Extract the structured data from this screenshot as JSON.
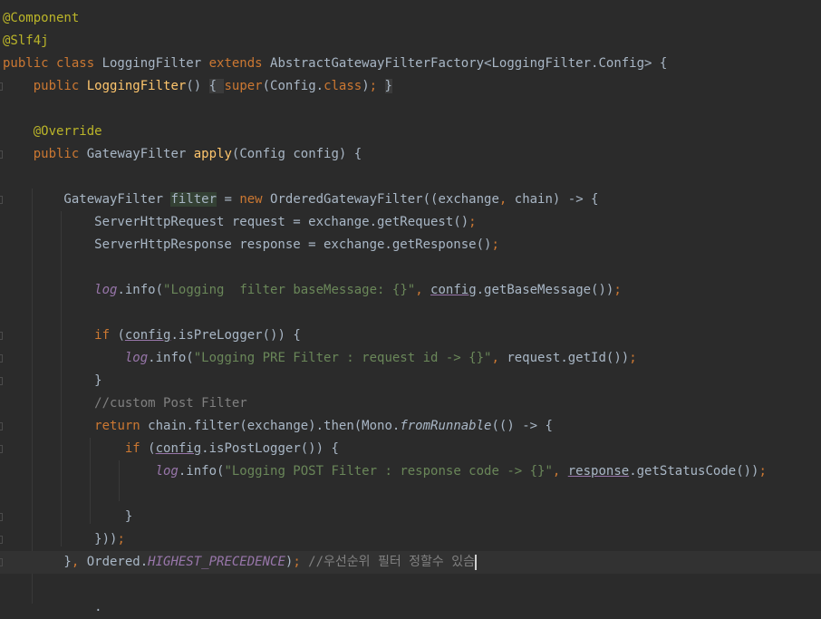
{
  "editor": {
    "lines": [
      {
        "tokens": [
          {
            "t": "@Component",
            "c": "ann"
          }
        ]
      },
      {
        "tokens": [
          {
            "t": "@Slf4j",
            "c": "ann"
          }
        ]
      },
      {
        "tokens": [
          {
            "t": "public class ",
            "c": "kw"
          },
          {
            "t": "LoggingFilter "
          },
          {
            "t": "extends ",
            "c": "kw"
          },
          {
            "t": "AbstractGatewayFilterFactory<LoggingFilter.Config> {"
          }
        ]
      },
      {
        "tokens": [
          {
            "t": "    "
          },
          {
            "t": "public ",
            "c": "kw"
          },
          {
            "t": "LoggingFilter",
            "c": "fn"
          },
          {
            "t": "() "
          },
          {
            "t": "{ ",
            "c": "fb"
          },
          {
            "t": "super",
            "c": "kw"
          },
          {
            "t": "(Config."
          },
          {
            "t": "class",
            "c": "kw"
          },
          {
            "t": ")"
          },
          {
            "t": "; ",
            "c": "kw"
          },
          {
            "t": "}",
            "c": "fb"
          }
        ]
      },
      {
        "tokens": []
      },
      {
        "tokens": [
          {
            "t": "    "
          },
          {
            "t": "@Override",
            "c": "ann"
          }
        ]
      },
      {
        "tokens": [
          {
            "t": "    "
          },
          {
            "t": "public ",
            "c": "kw"
          },
          {
            "t": "GatewayFilter "
          },
          {
            "t": "apply",
            "c": "fn"
          },
          {
            "t": "(Config config) {"
          }
        ]
      },
      {
        "tokens": []
      },
      {
        "tokens": [
          {
            "t": "        GatewayFilter "
          },
          {
            "t": "filter",
            "c": "hi"
          },
          {
            "t": " = "
          },
          {
            "t": "new ",
            "c": "kw"
          },
          {
            "t": "OrderedGatewayFilter((exchange"
          },
          {
            "t": ", ",
            "c": "kw"
          },
          {
            "t": "chain) -> {"
          }
        ]
      },
      {
        "tokens": [
          {
            "t": "            ServerHttpRequest request = exchange.getRequest()"
          },
          {
            "t": ";",
            "c": "kw"
          }
        ]
      },
      {
        "tokens": [
          {
            "t": "            ServerHttpResponse response = exchange.getResponse()"
          },
          {
            "t": ";",
            "c": "kw"
          }
        ]
      },
      {
        "tokens": []
      },
      {
        "tokens": [
          {
            "t": "            "
          },
          {
            "t": "log",
            "c": "fld it"
          },
          {
            "t": ".info("
          },
          {
            "t": "\"Logging  filter baseMessage: {}\"",
            "c": "str"
          },
          {
            "t": ", ",
            "c": "kw"
          },
          {
            "t": "config",
            "c": "ul"
          },
          {
            "t": ".getBaseMessage())"
          },
          {
            "t": ";",
            "c": "kw"
          }
        ]
      },
      {
        "tokens": []
      },
      {
        "tokens": [
          {
            "t": "            "
          },
          {
            "t": "if ",
            "c": "kw"
          },
          {
            "t": "("
          },
          {
            "t": "config",
            "c": "ul"
          },
          {
            "t": ".isPreLogger()) {"
          }
        ]
      },
      {
        "tokens": [
          {
            "t": "                "
          },
          {
            "t": "log",
            "c": "fld it"
          },
          {
            "t": ".info("
          },
          {
            "t": "\"Logging PRE Filter : request id -> {}\"",
            "c": "str"
          },
          {
            "t": ", ",
            "c": "kw"
          },
          {
            "t": "request.getId())"
          },
          {
            "t": ";",
            "c": "kw"
          }
        ]
      },
      {
        "tokens": [
          {
            "t": "            }"
          }
        ]
      },
      {
        "tokens": [
          {
            "t": "            "
          },
          {
            "t": "//custom Post Filter",
            "c": "cm"
          }
        ]
      },
      {
        "tokens": [
          {
            "t": "            "
          },
          {
            "t": "return ",
            "c": "kw"
          },
          {
            "t": "chain.filter(exchange).then(Mono."
          },
          {
            "t": "fromRunnable",
            "c": "it"
          },
          {
            "t": "(() -> {"
          }
        ]
      },
      {
        "tokens": [
          {
            "t": "                "
          },
          {
            "t": "if ",
            "c": "kw"
          },
          {
            "t": "("
          },
          {
            "t": "config",
            "c": "ul"
          },
          {
            "t": ".isPostLogger()) {"
          }
        ]
      },
      {
        "tokens": [
          {
            "t": "                    "
          },
          {
            "t": "log",
            "c": "fld it"
          },
          {
            "t": ".info("
          },
          {
            "t": "\"Logging POST Filter : response code -> {}\"",
            "c": "str"
          },
          {
            "t": ", ",
            "c": "kw"
          },
          {
            "t": "response",
            "c": "ul"
          },
          {
            "t": ".getStatusCode())"
          },
          {
            "t": ";",
            "c": "kw"
          }
        ]
      },
      {
        "tokens": []
      },
      {
        "tokens": [
          {
            "t": "                }"
          }
        ]
      },
      {
        "tokens": [
          {
            "t": "            }))"
          },
          {
            "t": ";",
            "c": "kw"
          }
        ]
      },
      {
        "tokens": [
          {
            "t": "        }"
          },
          {
            "t": ", ",
            "c": "kw"
          },
          {
            "t": "Ordered."
          },
          {
            "t": "HIGHEST_PRECEDENCE",
            "c": "fld it"
          },
          {
            "t": ")"
          },
          {
            "t": "; ",
            "c": "kw"
          },
          {
            "t": "//우선순위 필터 정할수 있슴",
            "c": "cm"
          }
        ]
      },
      {
        "tokens": []
      },
      {
        "tokens": [
          {
            "t": "            ."
          }
        ]
      }
    ]
  },
  "colors": {
    "background": "#2b2b2b",
    "keyword": "#cc7832",
    "annotation": "#bbb529",
    "method": "#ffc66d",
    "string": "#6a8759",
    "comment": "#808080",
    "field": "#9876aa"
  }
}
